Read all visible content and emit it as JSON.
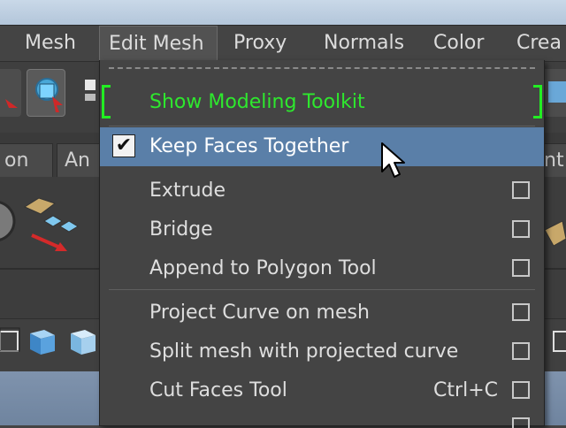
{
  "menubar": {
    "items": [
      "Mesh",
      "Edit Mesh",
      "Proxy",
      "Normals",
      "Color",
      "Crea"
    ],
    "active": "Edit Mesh"
  },
  "tabs": [
    "on",
    "An",
    "nt"
  ],
  "dropdown": {
    "toolkit_label": "Show Modeling Toolkit",
    "keep_faces": "Keep Faces Together",
    "keep_faces_check": "✔",
    "items": {
      "extrude": "Extrude",
      "bridge": "Bridge",
      "append": "Append to Polygon Tool",
      "project_curve": "Project Curve on mesh",
      "split_mesh": "Split mesh with projected curve",
      "cut_faces": "Cut Faces Tool",
      "cut_faces_shortcut": "Ctrl+C"
    }
  },
  "colors": {
    "highlight": "#5a7fa8",
    "toolkit_green": "#2ee82e",
    "background": "#444444"
  }
}
